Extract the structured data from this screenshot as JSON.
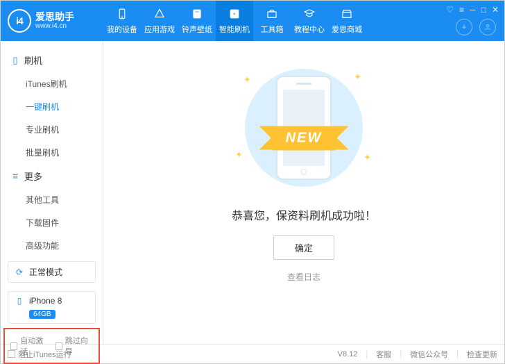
{
  "logo": {
    "brand": "爱思助手",
    "url": "www.i4.cn",
    "monogram": "i4"
  },
  "navs": [
    {
      "label": "我的设备",
      "icon": "device"
    },
    {
      "label": "应用游戏",
      "icon": "apps"
    },
    {
      "label": "铃声壁纸",
      "icon": "music"
    },
    {
      "label": "智能刷机",
      "icon": "flash",
      "active": true
    },
    {
      "label": "工具箱",
      "icon": "toolbox"
    },
    {
      "label": "教程中心",
      "icon": "tutorial"
    },
    {
      "label": "爱思商城",
      "icon": "store"
    }
  ],
  "sidebar": {
    "groups": [
      {
        "title": "刷机",
        "icon": "phone",
        "items": [
          {
            "label": "iTunes刷机"
          },
          {
            "label": "一键刷机",
            "active": true
          },
          {
            "label": "专业刷机"
          },
          {
            "label": "批量刷机"
          }
        ]
      },
      {
        "title": "更多",
        "icon": "more",
        "items": [
          {
            "label": "其他工具"
          },
          {
            "label": "下载固件"
          },
          {
            "label": "高级功能"
          }
        ]
      }
    ],
    "mode": {
      "label": "正常模式",
      "icon": "refresh"
    },
    "device": {
      "name": "iPhone 8",
      "storage": "64GB"
    },
    "bottomOptions": [
      {
        "label": "自动激活"
      },
      {
        "label": "跳过向导"
      }
    ]
  },
  "main": {
    "ribbon": "NEW",
    "success": "恭喜您，保资料刷机成功啦！",
    "ok": "确定",
    "viewLog": "查看日志"
  },
  "footer": {
    "blockItunes": "阻止iTunes运行",
    "version": "V8.12",
    "links": [
      "客服",
      "微信公众号",
      "检查更新"
    ]
  }
}
